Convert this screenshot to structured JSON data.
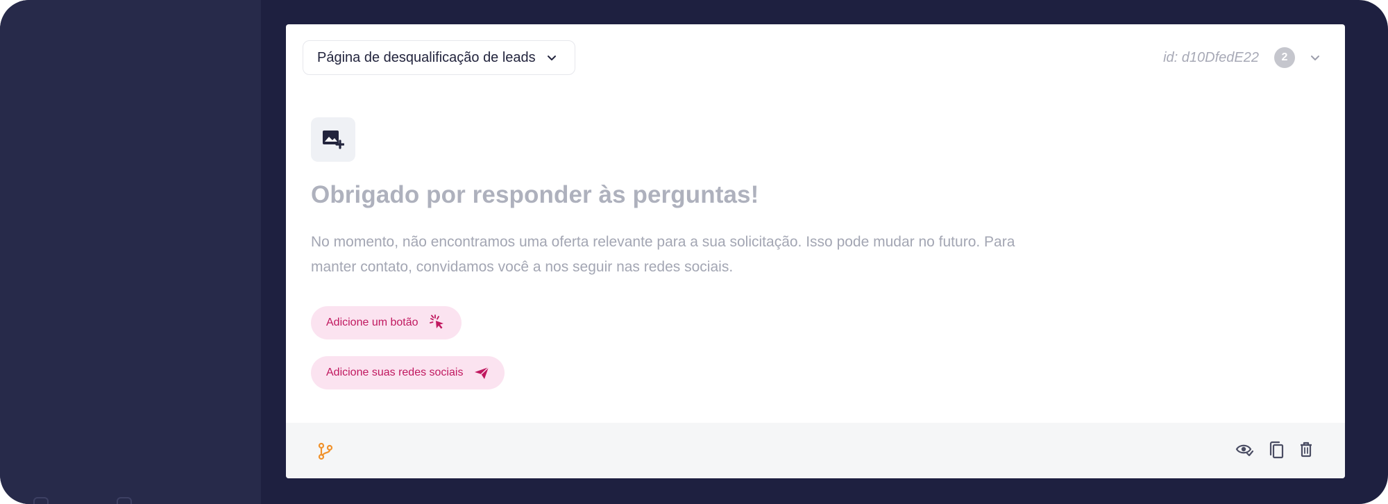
{
  "screen": {
    "page_selector": {
      "label": "Página de desqualificação de leads"
    },
    "step_id": "id: d10DfedE22",
    "badge_count": "2",
    "content": {
      "title": "Obrigado por responder às perguntas!",
      "description": "No momento, não encontramos uma oferta relevante para a sua solicitação. Isso pode mudar no futuro. Para manter contato, convidamos você a nos seguir nas redes sociais."
    },
    "actions": {
      "add_button_label": "Adicione um botão",
      "add_socials_label": "Adicione suas redes sociais"
    }
  },
  "icons": [
    "chevron-down-icon",
    "image-add-icon",
    "click-pointer-icon",
    "send-icon",
    "branch-icon",
    "eye-icon",
    "copy-icon",
    "trash-icon"
  ],
  "colors": {
    "frame_bg": "#1e2040",
    "accent_pink": "#c0185f",
    "chip_bg": "#fbe3f0",
    "branch_orange": "#f0922c"
  }
}
